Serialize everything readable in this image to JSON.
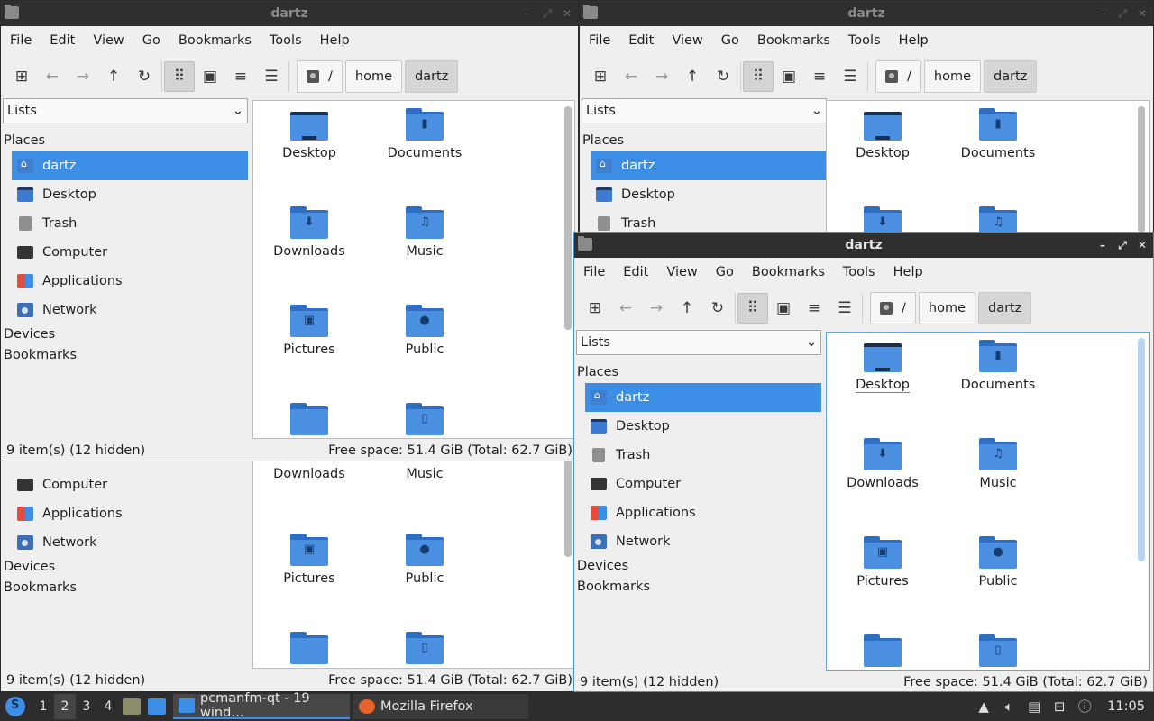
{
  "window": {
    "title": "dartz"
  },
  "menu": [
    "File",
    "Edit",
    "View",
    "Go",
    "Bookmarks",
    "Tools",
    "Help"
  ],
  "toolbar": {
    "icons": [
      "new-tab-icon",
      "back-arrow-icon",
      "forward-arrow-icon",
      "up-arrow-icon",
      "reload-icon",
      "icon-view-icon",
      "thumbnail-view-icon",
      "compact-view-icon",
      "detailed-list-view-icon"
    ]
  },
  "path": {
    "root": "/",
    "home": "home",
    "current": "dartz"
  },
  "sidebar": {
    "combo": "Lists",
    "places_heading": "Places",
    "items": [
      {
        "label": "dartz",
        "icon": "home-folder-icon"
      },
      {
        "label": "Desktop",
        "icon": "desktop-icon"
      },
      {
        "label": "Trash",
        "icon": "trash-icon"
      },
      {
        "label": "Computer",
        "icon": "computer-icon"
      },
      {
        "label": "Applications",
        "icon": "applications-icon"
      },
      {
        "label": "Network",
        "icon": "network-icon"
      }
    ],
    "devices_heading": "Devices",
    "bookmarks_heading": "Bookmarks"
  },
  "files": [
    {
      "name": "Desktop",
      "icon": "desktop-folder-icon"
    },
    {
      "name": "Documents",
      "icon": "documents-folder-icon"
    },
    {
      "name": "Downloads",
      "icon": "downloads-folder-icon"
    },
    {
      "name": "Music",
      "icon": "music-folder-icon"
    },
    {
      "name": "Pictures",
      "icon": "pictures-folder-icon"
    },
    {
      "name": "Public",
      "icon": "public-folder-icon"
    },
    {
      "name": "",
      "icon": "folder-icon"
    },
    {
      "name": "",
      "icon": "templates-folder-icon"
    }
  ],
  "status": {
    "items": "9 item(s) (12 hidden)",
    "free": "Free space: 51.4 GiB (Total: 62.7 GiB)"
  },
  "taskbar": {
    "workspaces": [
      "1",
      "2",
      "3",
      "4"
    ],
    "current_workspace": "2",
    "tasks": [
      {
        "label": "pcmanfm-qt - 19 wind…",
        "active": true
      },
      {
        "label": "Mozilla Firefox",
        "active": false
      }
    ],
    "clock": "11:05"
  },
  "colors": {
    "accent": "#3d8ee6",
    "folder": "#4a8fe0",
    "titlebar": "#2f2f2f",
    "taskbar": "#2d2d2d"
  }
}
